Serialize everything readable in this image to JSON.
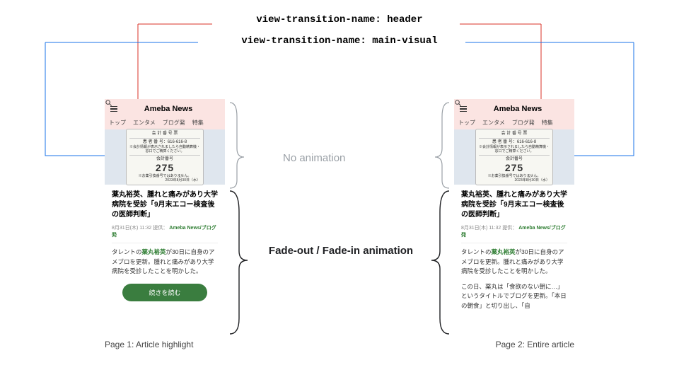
{
  "labels": {
    "vt_header": "view-transition-name: header",
    "vt_main": "view-transition-name: main-visual",
    "no_anim": "No animation",
    "fade": "Fade-out / Fade-in animation"
  },
  "phone": {
    "logo": "Ameba News",
    "tabs": [
      "トップ",
      "エンタメ",
      "ブログ発",
      "特集"
    ],
    "ticket": {
      "title": "会 計 番 号 票",
      "line1": "患 者 番 号：616-616-8",
      "line2": "※会計情報が表示されましたら自動精算機・窓口でご精算ください。",
      "label": "会計番号",
      "number": "275",
      "note": "※お薬引換番号ではありません。",
      "date": "2023年8月30日（水）"
    },
    "headline": "薬丸裕英、腫れと痛みがあり大学病院を受診「9月末エコー検査後の医師判断」",
    "meta_date": "8月31日(木) 11:32",
    "meta_prefix": "提供：",
    "meta_src": "Ameba News/ブログ発",
    "excerpt_pre": "タレントの",
    "excerpt_link": "薬丸裕英",
    "excerpt_post": "が30日に自身のアメブロを更新。腫れと痛みがあり大学病院を受診したことを明かした。",
    "cta": "続きを読む",
    "p2_para": "この日、薬丸は「食欲のない朝に…」というタイトルでブログを更新。「本日の朝食」と切り出し、「自"
  },
  "captions": {
    "page1": "Page 1: Article highlight",
    "page2": "Page 2: Entire article"
  }
}
